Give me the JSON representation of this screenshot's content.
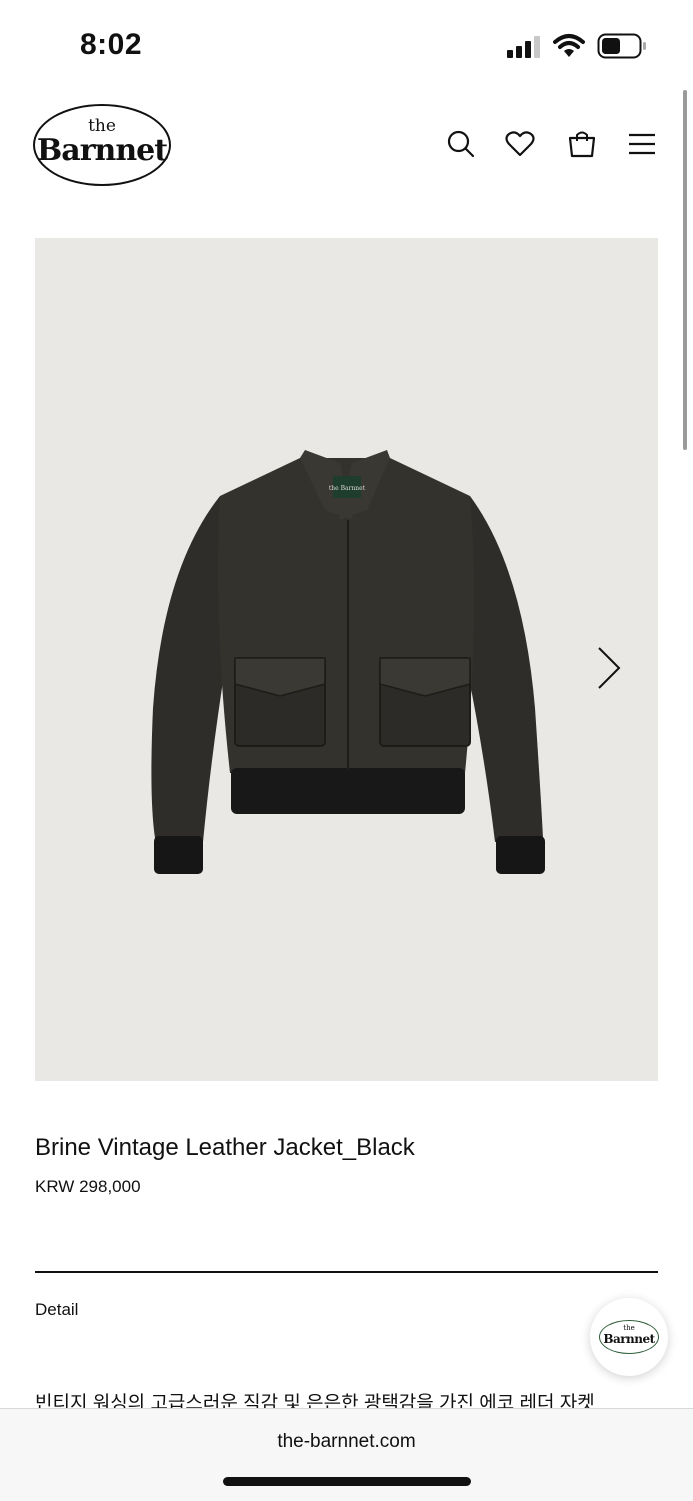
{
  "status_bar": {
    "time": "8:02"
  },
  "header": {
    "logo_top": "the",
    "logo_name": "Barnnet",
    "icons": [
      "search-icon",
      "heart-icon",
      "bag-icon",
      "menu-icon"
    ]
  },
  "product": {
    "image_label": "the Barnnet",
    "title": "Brine Vintage Leather Jacket_Black",
    "price": "KRW 298,000"
  },
  "detail": {
    "label": "Detail",
    "description": "빈티지 워싱의 고급스러운 직감 및 은은한 광택감을 가진 에코 레더 자켓"
  },
  "chat_badge": {
    "top": "the",
    "name": "Barnnet"
  },
  "browser": {
    "url": "the-barnnet.com"
  },
  "colors": {
    "image_bg": "#e9e8e4",
    "jacket": "#2b2a26",
    "badge_accent": "#2f5d3a"
  }
}
